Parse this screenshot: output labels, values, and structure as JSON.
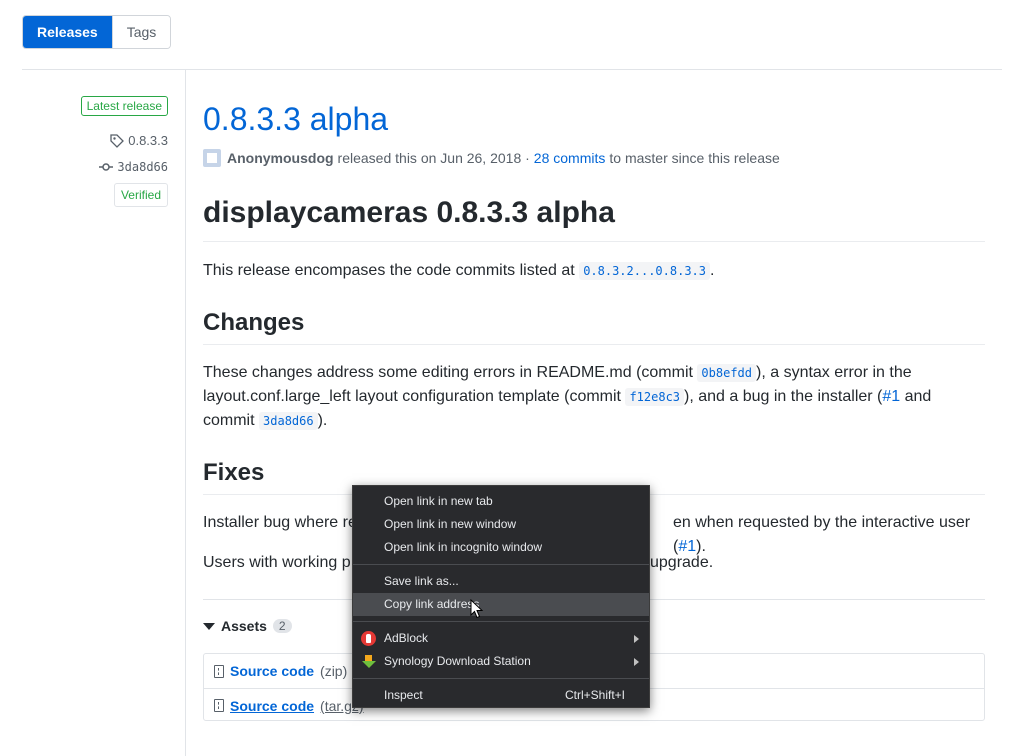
{
  "tabs": [
    {
      "label": "Releases",
      "active": true
    },
    {
      "label": "Tags",
      "active": false
    }
  ],
  "sidebar": {
    "latest_badge": "Latest release",
    "tag": "0.8.3.3",
    "commit": "3da8d66",
    "verified": "Verified"
  },
  "release": {
    "title": "0.8.3.3 alpha",
    "author": "Anonymousdog",
    "released_text": "released this on Jun 26, 2018 ·",
    "commits_link": "28 commits",
    "commits_suffix": "to master since this release"
  },
  "body": {
    "heading": "displaycameras 0.8.3.3 alpha",
    "intro_text": "This release encompases the code commits listed at",
    "intro_code": "0.8.3.2...0.8.3.3",
    "intro_end": ".",
    "changes_heading": "Changes",
    "changes_p1": "These changes address some editing errors in README.md (commit",
    "changes_code1": "0b8efdd",
    "changes_p2": "), a syntax error in the",
    "changes_p3": "layout.conf.large_left layout configuration template (commit",
    "changes_code2": "f12e8c3",
    "changes_p4": "), and a bug in the installer (",
    "changes_link": "#1",
    "changes_p5": "and",
    "changes_p6": "commit",
    "changes_code3": "3da8d66",
    "changes_p7": ").",
    "fixes_heading": "Fixes",
    "fixes_p1_start": "Installer bug where re",
    "fixes_p1_end": "en when requested by the interactive user (",
    "fixes_link": "#1",
    "fixes_p1_close": ").",
    "fixes_p2_start": "Users with working p",
    "fixes_p2_end": "upgrade."
  },
  "assets": {
    "label": "Assets",
    "count": "2",
    "items": [
      {
        "name": "Source code",
        "type": "(zip)"
      },
      {
        "name": "Source code",
        "type": "(tar.gz)"
      }
    ]
  },
  "context_menu": {
    "items": [
      {
        "label": "Open link in new tab"
      },
      {
        "label": "Open link in new window"
      },
      {
        "label": "Open link in incognito window"
      },
      {
        "label": "Save link as..."
      },
      {
        "label": "Copy link address"
      },
      {
        "label": "AdBlock"
      },
      {
        "label": "Synology Download Station"
      },
      {
        "label": "Inspect",
        "shortcut": "Ctrl+Shift+I"
      }
    ]
  }
}
